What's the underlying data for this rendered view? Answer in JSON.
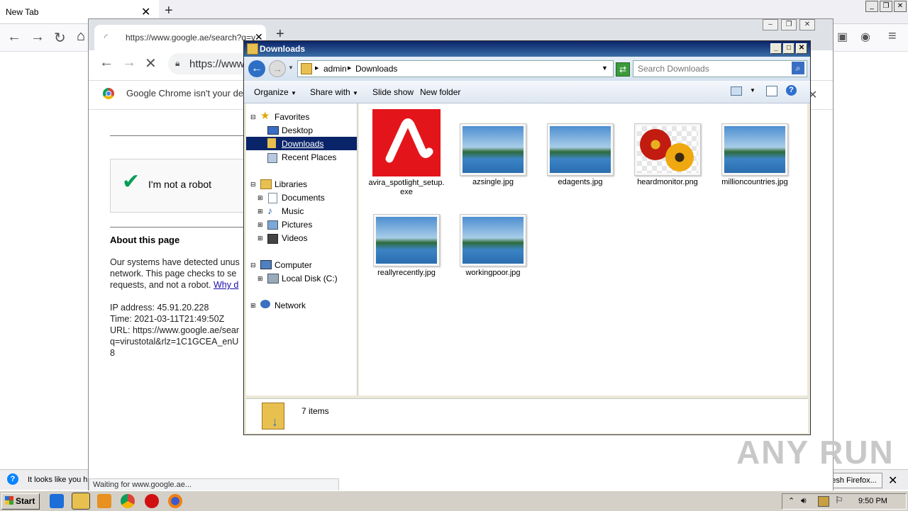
{
  "firefox": {
    "tab_title": "New Tab",
    "new_tab_symbol": "+",
    "notification_text": "It looks like you h",
    "refresh_button": "esh Firefox...",
    "close_symbol": "✕"
  },
  "chrome": {
    "tab_url": "https://www.google.ae/search?q=v",
    "omnibox_url": "https://www",
    "infobar_text": "Google Chrome isn't your defa",
    "status_text": "Waiting for www.google.ae..."
  },
  "google_page": {
    "captcha_label": "I'm not a robot",
    "about_title": "About this page",
    "text_line1": "Our systems have detected unus",
    "text_line2": "network. This page checks to se",
    "text_line3": "requests, and not a robot.",
    "why_link": "Why d",
    "ip_line": "IP address: 45.91.20.228",
    "time_line": "Time: 2021-03-11T21:49:50Z",
    "url_line1": "URL: https://www.google.ae/sear",
    "url_line2": "q=virustotal&rlz=1C1GCEA_enU",
    "url_line3": "8"
  },
  "explorer": {
    "title": "Downloads",
    "breadcrumb": [
      "admin",
      "Downloads"
    ],
    "search_placeholder": "Search Downloads",
    "commands": {
      "organize": "Organize",
      "share_with": "Share with",
      "slide_show": "Slide show",
      "new_folder": "New folder"
    },
    "nav": {
      "favorites": "Favorites",
      "desktop": "Desktop",
      "downloads": "Downloads",
      "recent_places": "Recent Places",
      "libraries": "Libraries",
      "documents": "Documents",
      "music": "Music",
      "pictures": "Pictures",
      "videos": "Videos",
      "computer": "Computer",
      "local_disk": "Local Disk (C:)",
      "network": "Network"
    },
    "files": [
      {
        "name": "avira_spotlight_setup.exe",
        "type": "exe"
      },
      {
        "name": "azsingle.jpg",
        "type": "landscape"
      },
      {
        "name": "edagents.jpg",
        "type": "landscape"
      },
      {
        "name": "heardmonitor.png",
        "type": "flowers"
      },
      {
        "name": "millioncountries.jpg",
        "type": "landscape"
      },
      {
        "name": "reallyrecently.jpg",
        "type": "landscape"
      },
      {
        "name": "workingpoor.jpg",
        "type": "landscape"
      }
    ],
    "item_count": "7 items"
  },
  "taskbar": {
    "start_label": "Start",
    "clock": "9:50 PM"
  },
  "watermark": "ANY RUN"
}
